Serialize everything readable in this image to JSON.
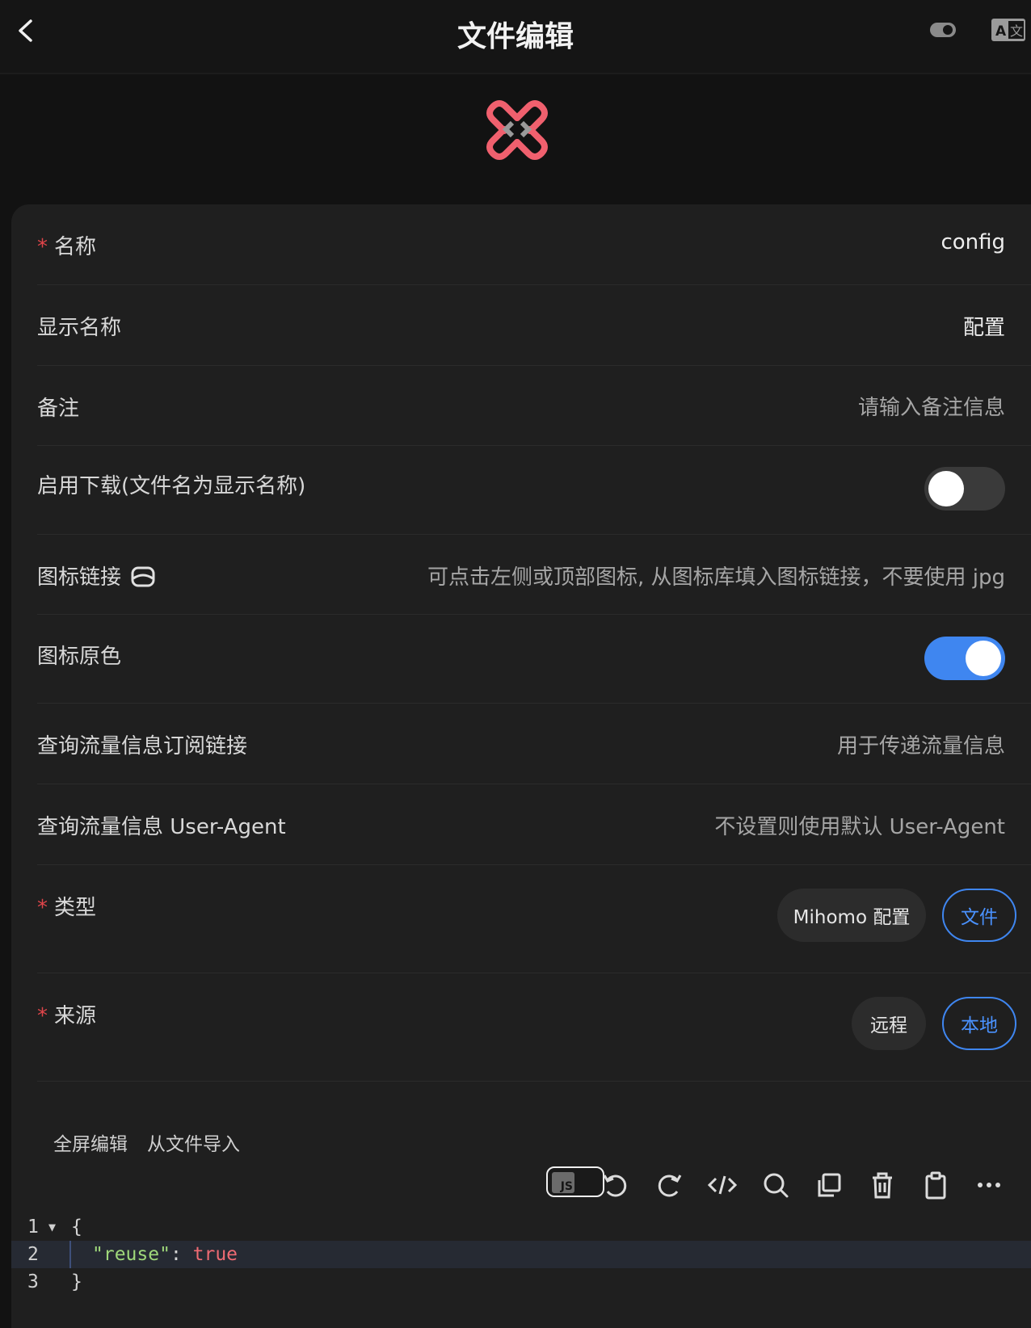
{
  "header": {
    "title": "文件编辑",
    "back_icon": "chevron-left-icon",
    "theme_icon": "toggle-icon",
    "lang_icon": "translate-icon"
  },
  "logo_icon": "app-logo-icon",
  "form": {
    "name": {
      "label": "名称",
      "required": "*",
      "value": "config"
    },
    "display_name": {
      "label": "显示名称",
      "value": "配置"
    },
    "remark": {
      "label": "备注",
      "placeholder": "请输入备注信息"
    },
    "download": {
      "label": "启用下载(文件名为显示名称)",
      "enabled": false
    },
    "icon_link": {
      "label": "图标链接",
      "icon": "image-icon",
      "placeholder": "可点击左侧或顶部图标, 从图标库填入图标链接，不要使用 jpg"
    },
    "icon_original_color": {
      "label": "图标原色",
      "enabled": true
    },
    "traffic_sub": {
      "label": "查询流量信息订阅链接",
      "placeholder": "用于传递流量信息"
    },
    "traffic_ua": {
      "label": "查询流量信息 User-Agent",
      "placeholder": "不设置则使用默认 User-Agent"
    },
    "type": {
      "label": "类型",
      "required": "*",
      "options": [
        "Mihomo 配置",
        "文件"
      ],
      "selected": "文件"
    },
    "source": {
      "label": "来源",
      "required": "*",
      "options": [
        "远程",
        "本地"
      ],
      "selected": "本地"
    }
  },
  "editor_links": {
    "fullscreen": "全屏编辑",
    "import": "从文件导入"
  },
  "toolbar": {
    "js_label": "JS",
    "icons": [
      "undo-icon",
      "redo-icon",
      "code-icon",
      "search-icon",
      "copy-icon",
      "delete-icon",
      "paste-icon",
      "more-icon"
    ]
  },
  "editor": {
    "lines": [
      {
        "num": "1",
        "text": "{"
      },
      {
        "num": "2",
        "key": "\"reuse\"",
        "sep": ": ",
        "value": "true"
      },
      {
        "num": "3",
        "text": "}"
      }
    ]
  },
  "colors": {
    "accent": "#3f86f0",
    "required": "#e0454a",
    "logo": "#f0606e"
  }
}
